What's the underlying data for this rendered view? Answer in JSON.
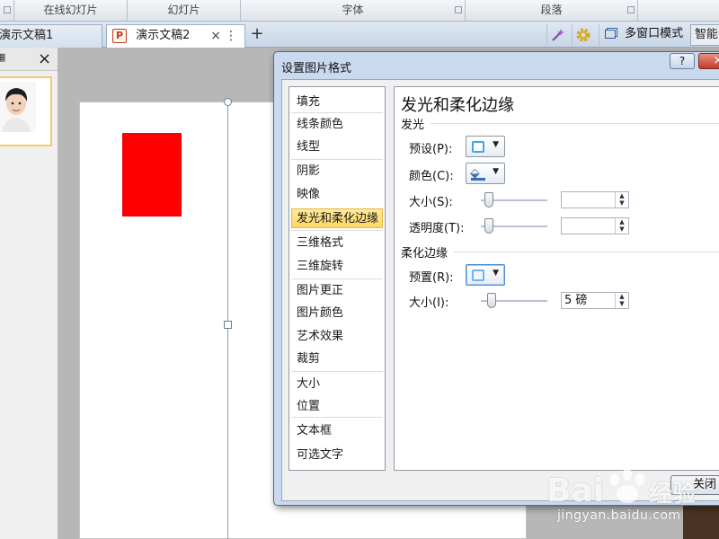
{
  "ribbon": {
    "groups": [
      "在线幻灯片",
      "幻灯片",
      "字体",
      "段落"
    ]
  },
  "tabbar": {
    "tab1": "演示文稿1",
    "tab2": "演示文稿2",
    "tab2_icon": "P",
    "close_glyph": "×",
    "more_glyph": "⋮",
    "new_tab_glyph": "+",
    "multi_window_label": "多窗口模式",
    "smart_label": "智能"
  },
  "thumbnails": {
    "close_glyph": "×"
  },
  "dialog": {
    "title": "设置图片格式",
    "help_glyph": "?",
    "close_glyph": "×",
    "categories": [
      "填充",
      "线条颜色",
      "线型",
      "阴影",
      "映像",
      "发光和柔化边缘",
      "三维格式",
      "三维旋转",
      "图片更正",
      "图片颜色",
      "艺术效果",
      "裁剪",
      "大小",
      "位置",
      "文本框",
      "可选文字"
    ],
    "selected_category": "发光和柔化边缘",
    "panel": {
      "title": "发光和柔化边缘",
      "glow": {
        "section": "发光",
        "preset_label": "预设(P):",
        "color_label": "颜色(C):",
        "size_label": "大小(S):",
        "size_value": "",
        "transparency_label": "透明度(T):",
        "transparency_value": "",
        "size_fraction": 0.0,
        "transparency_fraction": 0.0
      },
      "soft_edges": {
        "section": "柔化边缘",
        "preset_label": "预置(R):",
        "size_label": "大小(I):",
        "size_value": "5 磅",
        "size_fraction": 0.05
      }
    },
    "close_button": "关闭"
  },
  "watermark": {
    "logo_text": "Bai",
    "logo_suffix": "经验",
    "url": "jingyan.baidu.com"
  },
  "colors": {
    "shape_fill": "#ff0000",
    "selection_highlight": "#ffd862",
    "dialog_frame": "#c9d9ee"
  }
}
